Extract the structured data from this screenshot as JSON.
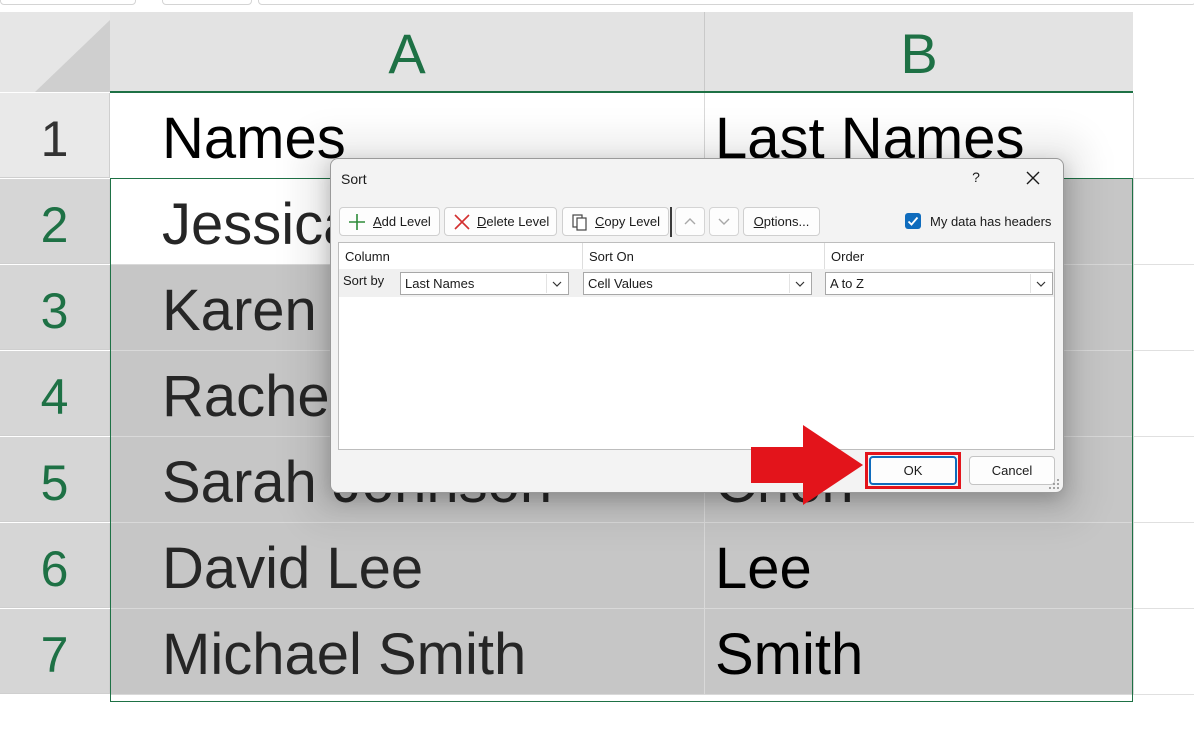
{
  "spreadsheet": {
    "column_headers": [
      "A",
      "B"
    ],
    "row_headers": [
      "1",
      "2",
      "3",
      "4",
      "5",
      "6",
      "7"
    ],
    "rows": [
      {
        "a": "Names",
        "b": "Last Names"
      },
      {
        "a": "Jessica",
        "b": ""
      },
      {
        "a": "Karen C",
        "b": ""
      },
      {
        "a": "Rachel",
        "b": ""
      },
      {
        "a": "Sarah Johnson",
        "b": "Chen"
      },
      {
        "a": "David Lee",
        "b": "Lee"
      },
      {
        "a": "Michael Smith",
        "b": "Smith"
      }
    ],
    "accent_color": "#1e7145"
  },
  "dialog": {
    "title": "Sort",
    "help_label": "?",
    "close_icon": "close-icon",
    "toolbar": {
      "add_level_key": "A",
      "add_level_rest": "dd Level",
      "delete_level_key": "D",
      "delete_level_rest": "elete Level",
      "copy_level_key": "C",
      "copy_level_rest": "opy Level",
      "move_up_icon": "chevron-up-icon",
      "move_down_icon": "chevron-down-icon",
      "options_key": "O",
      "options_rest": "ptions..."
    },
    "my_data_has_headers": {
      "label": "My data has headers",
      "checked": true
    },
    "columns": {
      "column": "Column",
      "sort_on": "Sort On",
      "order": "Order"
    },
    "level": {
      "label": "Sort by",
      "column": "Last Names",
      "sort_on": "Cell Values",
      "order": "A to Z"
    },
    "ok_label": "OK",
    "cancel_label": "Cancel",
    "highlight_color": "#e3141b",
    "primary_color": "#0f6cbd"
  }
}
